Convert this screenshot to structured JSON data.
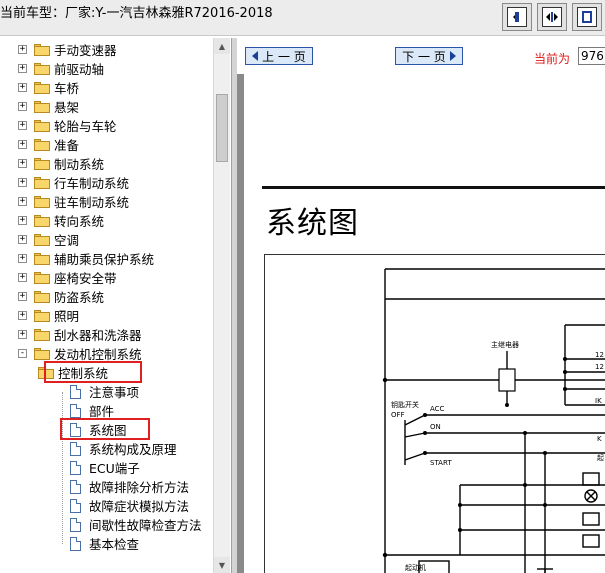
{
  "window": {
    "title": "当前车型：厂家:Y-一汽吉林森雅R72016-2018"
  },
  "toolbar": {
    "buttons": [
      "fit-width",
      "fit-both",
      "fit-page"
    ]
  },
  "tree": {
    "items": [
      {
        "label": "手动变速器",
        "type": "folder",
        "expander": "+"
      },
      {
        "label": "前驱动轴",
        "type": "folder",
        "expander": "+"
      },
      {
        "label": "车桥",
        "type": "folder",
        "expander": "+"
      },
      {
        "label": "悬架",
        "type": "folder",
        "expander": "+"
      },
      {
        "label": "轮胎与车轮",
        "type": "folder",
        "expander": "+"
      },
      {
        "label": "准备",
        "type": "folder",
        "expander": "+"
      },
      {
        "label": "制动系统",
        "type": "folder",
        "expander": "+"
      },
      {
        "label": "行车制动系统",
        "type": "folder",
        "expander": "+"
      },
      {
        "label": "驻车制动系统",
        "type": "folder",
        "expander": "+"
      },
      {
        "label": "转向系统",
        "type": "folder",
        "expander": "+"
      },
      {
        "label": "空调",
        "type": "folder",
        "expander": "+"
      },
      {
        "label": "辅助乘员保护系统",
        "type": "folder",
        "expander": "+"
      },
      {
        "label": "座椅安全带",
        "type": "folder",
        "expander": "+"
      },
      {
        "label": "防盗系统",
        "type": "folder",
        "expander": "+"
      },
      {
        "label": "照明",
        "type": "folder",
        "expander": "+"
      },
      {
        "label": "刮水器和洗涤器",
        "type": "folder",
        "expander": "+"
      },
      {
        "label": "发动机控制系统",
        "type": "folder",
        "expander": "-"
      },
      {
        "label": "控制系统",
        "type": "folder",
        "expander": "-"
      },
      {
        "label": "注意事项",
        "type": "doc"
      },
      {
        "label": "部件",
        "type": "doc"
      },
      {
        "label": "系统图",
        "type": "doc"
      },
      {
        "label": "系统构成及原理",
        "type": "doc"
      },
      {
        "label": "ECU端子",
        "type": "doc"
      },
      {
        "label": "故障排除分析方法",
        "type": "doc"
      },
      {
        "label": "故障症状模拟方法",
        "type": "doc"
      },
      {
        "label": "间歇性故障检查方法",
        "type": "doc"
      },
      {
        "label": "基本检查",
        "type": "doc"
      }
    ]
  },
  "viewer": {
    "prev_label": "上 一 页",
    "next_label": "下 一 页",
    "current_label": "当前为",
    "current_page": "976",
    "page_heading": "系统图"
  },
  "diagram": {
    "labels": {
      "main_relay": "主继电器",
      "ignition_switch": "钥匙开关",
      "off": "OFF",
      "acc": "ACC",
      "on": "ON",
      "start": "START",
      "starter_motor": "起动机",
      "pin_12a": "12",
      "pin_12b": "12",
      "pin_ik": "IK",
      "pin_k": "K",
      "pin_qi": "起"
    }
  },
  "colors": {
    "highlight_box": "#e02020",
    "current_label": "#e01a1a",
    "nav_border": "#2b54a6"
  }
}
